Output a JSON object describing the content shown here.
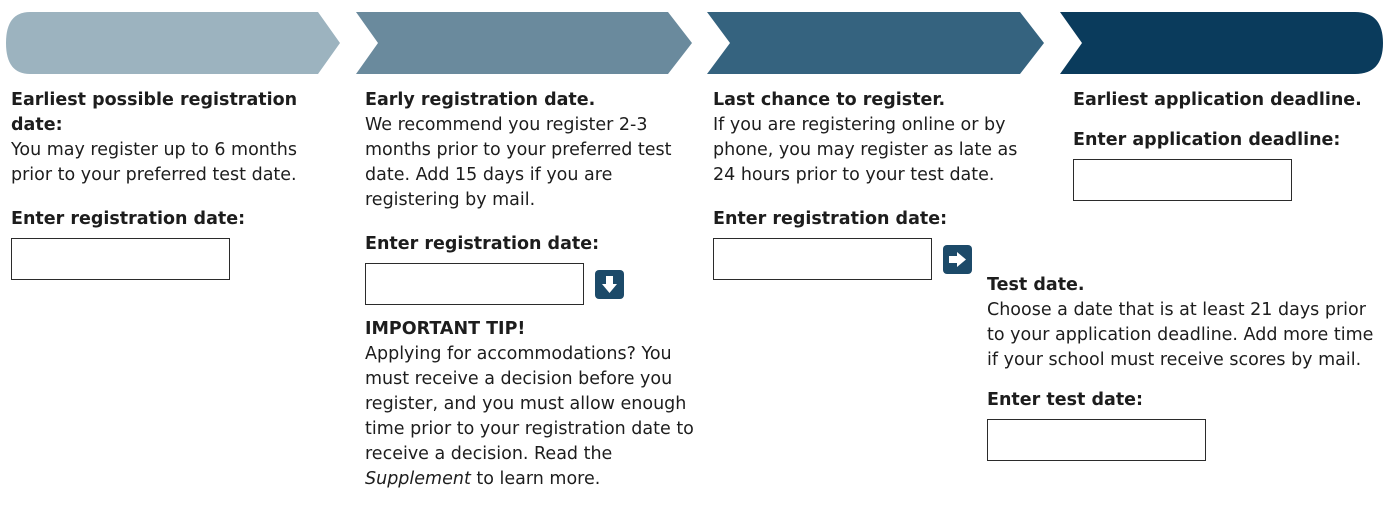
{
  "colors": {
    "step1": "#9cb3bf",
    "step2": "#6a8a9d",
    "step3": "#35637f",
    "step4": "#0a3b5c",
    "icon": "#1c4a69"
  },
  "steps": [
    {
      "heading": "Earliest possible registration date:",
      "body": "You may register up to 6 months prior to your preferred test date.",
      "input_label": "Enter registration date:",
      "input_value": ""
    },
    {
      "heading": "Early registration date.",
      "body": "We recommend you register 2-3 months prior to your preferred test date. Add 15 days if you are registering by mail.",
      "input_label": "Enter registration date:",
      "input_value": "",
      "icon": "arrow-down-icon",
      "tip": {
        "title": "IMPORTANT TIP!",
        "body_before": "Applying for accommodations? You must receive a decision before you register, and you must allow enough time prior to your registration date to receive a decision. Read the ",
        "body_emphasis": "Supplement",
        "body_after": " to learn more."
      }
    },
    {
      "heading": "Last chance to register.",
      "body": "If you are registering online or by phone, you may register as late as 24 hours prior to your test date.",
      "input_label": "Enter registration date:",
      "input_value": "",
      "icon": "arrow-right-icon"
    },
    {
      "heading": "Earliest application deadline.",
      "input_label": "Enter application deadline:",
      "input_value": ""
    }
  ],
  "test_date": {
    "heading": "Test date.",
    "body": "Choose a date that is at least 21 days prior to your application deadline. Add more time if your school must receive scores by mail.",
    "input_label": "Enter test date:",
    "input_value": ""
  }
}
